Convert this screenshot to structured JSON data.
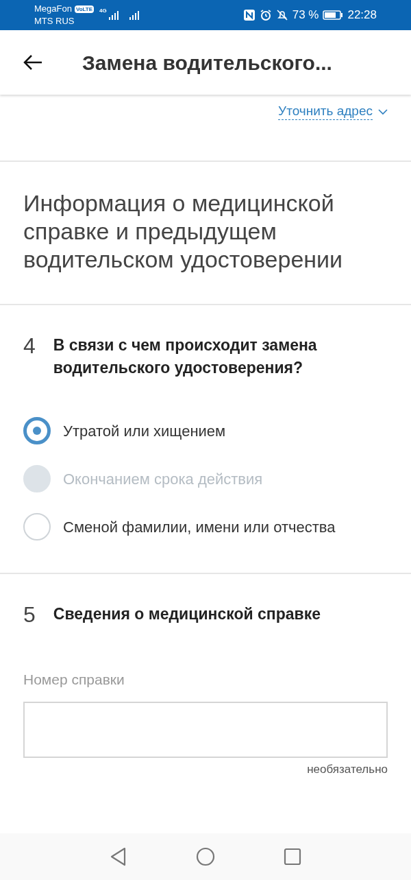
{
  "status_bar": {
    "carriers": [
      "MegaFon",
      "MTS RUS"
    ],
    "volte": "VoLTE",
    "network": "4G",
    "battery": "73 %",
    "time": "22:28"
  },
  "app_bar": {
    "title": "Замена водительского..."
  },
  "address_link": "Уточнить адрес",
  "section_title": "Информация о медицинской справке и предыдущем водительском удостоверении",
  "questions": [
    {
      "number": "4",
      "title": "В связи с чем происходит замена водительского удостоверения?",
      "options": [
        {
          "label": "Утратой или хищением",
          "selected": true,
          "disabled": false
        },
        {
          "label": "Окончанием срока действия",
          "selected": false,
          "disabled": true
        },
        {
          "label": "Сменой фамилии, имени или отчества",
          "selected": false,
          "disabled": false
        }
      ]
    },
    {
      "number": "5",
      "title": "Сведения о медицинской справке",
      "field": {
        "label": "Номер справки",
        "hint": "необязательно"
      }
    }
  ]
}
